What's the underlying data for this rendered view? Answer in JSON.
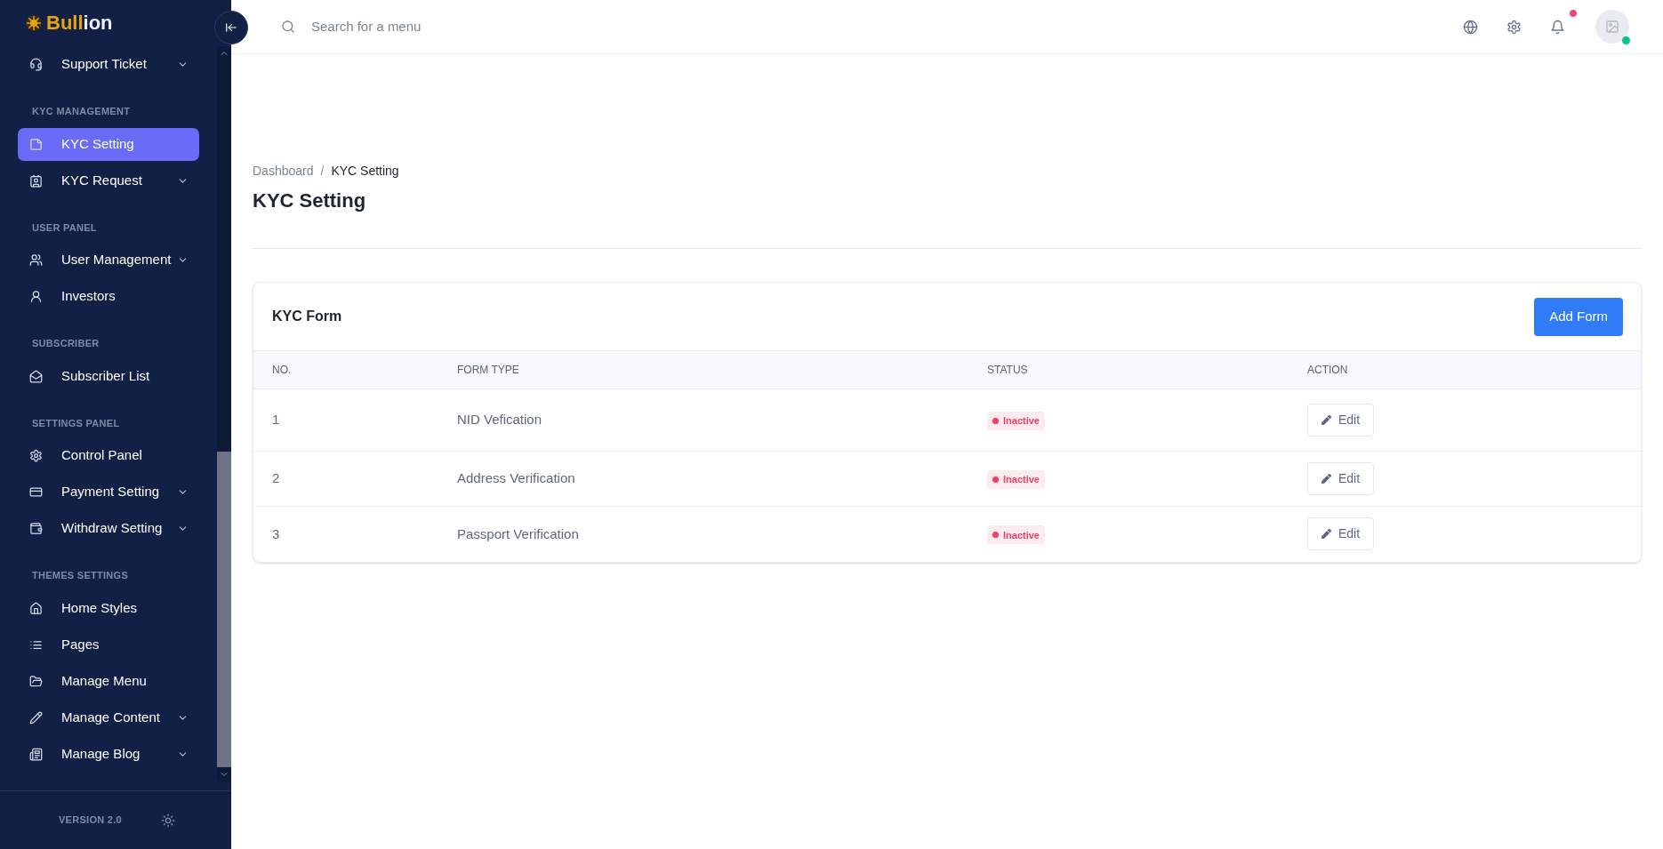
{
  "brand": {
    "name_a": "Bull",
    "name_b": "ion"
  },
  "sidebar": {
    "sections": [
      {
        "items": [
          {
            "label": "Support Ticket",
            "expandable": true,
            "selected": false
          }
        ]
      },
      {
        "heading": "KYC MANAGEMENT",
        "items": [
          {
            "label": "KYC Setting",
            "expandable": false,
            "selected": true
          },
          {
            "label": "KYC Request",
            "expandable": true,
            "selected": false
          }
        ]
      },
      {
        "heading": "USER PANEL",
        "items": [
          {
            "label": "User Management",
            "expandable": true,
            "selected": false
          },
          {
            "label": "Investors",
            "expandable": false,
            "selected": false
          }
        ]
      },
      {
        "heading": "SUBSCRIBER",
        "items": [
          {
            "label": "Subscriber List",
            "expandable": false,
            "selected": false
          }
        ]
      },
      {
        "heading": "SETTINGS PANEL",
        "items": [
          {
            "label": "Control Panel",
            "expandable": false,
            "selected": false
          },
          {
            "label": "Payment Setting",
            "expandable": true,
            "selected": false
          },
          {
            "label": "Withdraw Setting",
            "expandable": true,
            "selected": false
          }
        ]
      },
      {
        "heading": "THEMES SETTINGS",
        "items": [
          {
            "label": "Home Styles",
            "expandable": false,
            "selected": false
          },
          {
            "label": "Pages",
            "expandable": false,
            "selected": false
          },
          {
            "label": "Manage Menu",
            "expandable": false,
            "selected": false
          },
          {
            "label": "Manage Content",
            "expandable": true,
            "selected": false
          },
          {
            "label": "Manage Blog",
            "expandable": true,
            "selected": false
          }
        ]
      }
    ],
    "version": "VERSION 2.0"
  },
  "header": {
    "search": {
      "placeholder": "Search for a menu"
    },
    "notifications_unread": true,
    "user_online": true
  },
  "breadcrumb": [
    "Dashboard",
    "KYC Setting"
  ],
  "breadcrumb_separator": "/",
  "page_title": "KYC Setting",
  "card": {
    "title": "KYC Form",
    "button": "Add Form",
    "table": {
      "columns": [
        "NO.",
        "FORM TYPE",
        "STATUS",
        "ACTION"
      ],
      "rows": [
        {
          "no": "1",
          "form_type": "NID Vefication",
          "status": "Inactive",
          "active": false,
          "action": "Edit"
        },
        {
          "no": "2",
          "form_type": "Address Verification",
          "status": "Inactive",
          "active": false,
          "action": "Edit"
        },
        {
          "no": "3",
          "form_type": "Passport Verification",
          "status": "Inactive",
          "active": false,
          "action": "Edit"
        }
      ]
    }
  }
}
